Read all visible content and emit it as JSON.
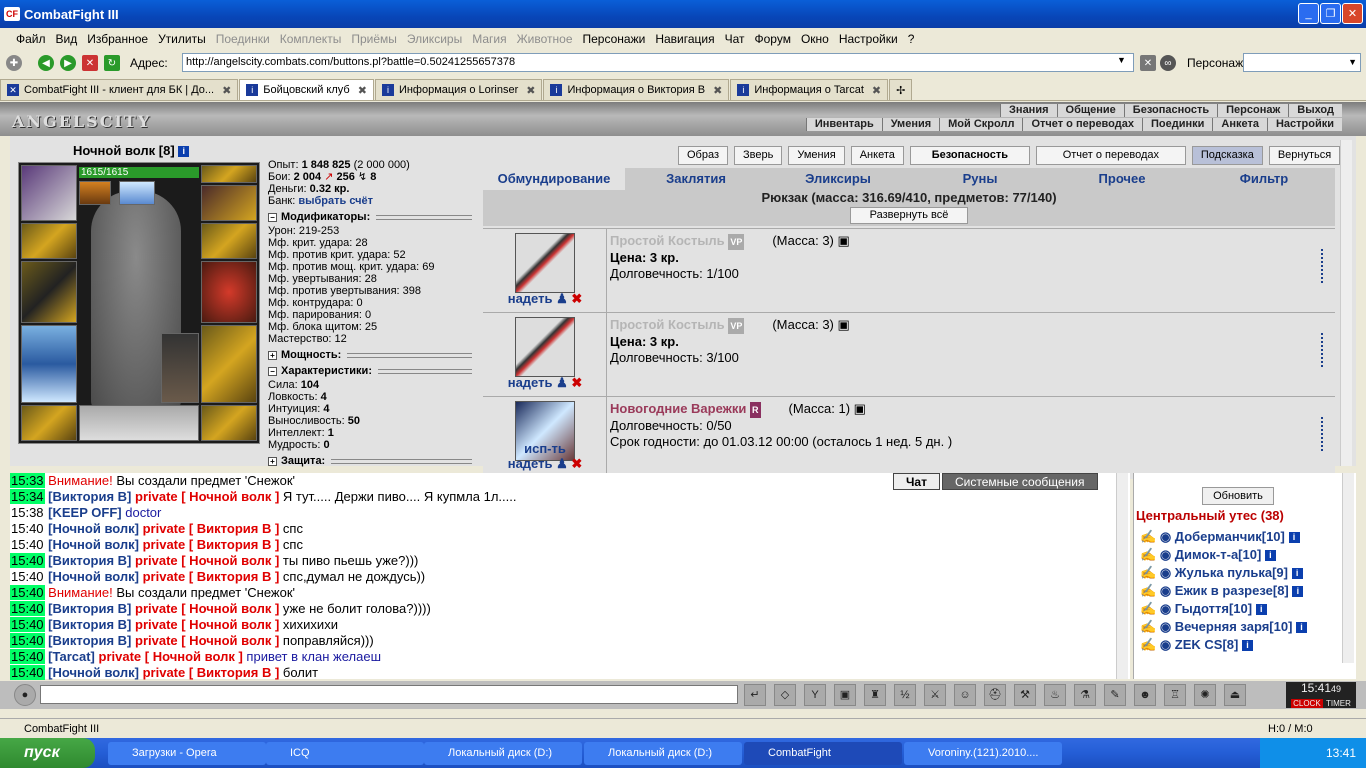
{
  "window": {
    "title": "CombatFight III"
  },
  "menu": {
    "items": [
      {
        "label": "Файл",
        "enabled": true
      },
      {
        "label": "Вид",
        "enabled": true
      },
      {
        "label": "Избранное",
        "enabled": true
      },
      {
        "label": "Утилиты",
        "enabled": true
      },
      {
        "label": "Поединки",
        "enabled": false
      },
      {
        "label": "Комплекты",
        "enabled": false
      },
      {
        "label": "Приёмы",
        "enabled": false
      },
      {
        "label": "Эликсиры",
        "enabled": false
      },
      {
        "label": "Магия",
        "enabled": false
      },
      {
        "label": "Животное",
        "enabled": false
      },
      {
        "label": "Персонажи",
        "enabled": true
      },
      {
        "label": "Навигация",
        "enabled": true
      },
      {
        "label": "Чат",
        "enabled": true
      },
      {
        "label": "Форум",
        "enabled": true
      },
      {
        "label": "Окно",
        "enabled": true
      },
      {
        "label": "Настройки",
        "enabled": true
      },
      {
        "label": "?",
        "enabled": true
      }
    ]
  },
  "address": {
    "label": "Адрес:",
    "url": "http://angelscity.combats.com/buttons.pl?battle=0.50241255657378",
    "persona_label": "Персонаж:"
  },
  "tabs": [
    {
      "label": "CombatFight III - клиент для БК | До..."
    },
    {
      "label": "Бойцовский клуб",
      "active": true
    },
    {
      "label": "Информация о Lorinser"
    },
    {
      "label": "Информация о Виктория В"
    },
    {
      "label": "Информация о Tarcat"
    }
  ],
  "header": {
    "logo": "ANGELSCITY",
    "links_row1": [
      "Знания",
      "Общение",
      "Безопасность",
      "Персонаж",
      "Выход"
    ],
    "links_row2": [
      "Инвентарь",
      "Умения",
      "Мой Скролл",
      "Отчет о переводах",
      "Поединки",
      "Анкета",
      "Настройки"
    ]
  },
  "character": {
    "name": "Ночной волк [8]",
    "hp": "1615/1615",
    "hp_fraction": 1.0,
    "stats": {
      "exp": "Опыт:",
      "exp_val": "1 848 825",
      "exp_next": "(2 000 000)",
      "fights": "Бои:",
      "fights_val": "2 004",
      "wins": "256",
      "losses": "8",
      "money": "Деньги:",
      "money_val": "0.32 кр.",
      "bank": "Банк:",
      "bank_link": "выбрать счёт"
    },
    "modifiers_title": "Модификаторы:",
    "modifiers": [
      "Урон: 219-253",
      "Мф. крит. удара: 28",
      "Мф. против крит. удара: 52",
      "Мф. против мощ. крит. удара: 69",
      "Мф. увертывания: 28",
      "Мф. против увертывания: 398",
      "Мф. контрудара: 0",
      "Мф. парирования: 0",
      "Мф. блока щитом: 25",
      "Мастерство: 12"
    ],
    "power_title": "Мощность:",
    "chars_title": "Характеристики:",
    "chars": [
      {
        "k": "Сила:",
        "v": "104"
      },
      {
        "k": "Ловкость:",
        "v": "4"
      },
      {
        "k": "Интуиция:",
        "v": "4"
      },
      {
        "k": "Выносливость:",
        "v": "50"
      },
      {
        "k": "Интеллект:",
        "v": "1"
      },
      {
        "k": "Мудрость:",
        "v": "0"
      }
    ],
    "defense_title": "Защита:"
  },
  "buttons": [
    "Образ",
    "Зверь",
    "Умения",
    "Анкета",
    "Безопасность",
    "Отчет о переводах",
    "Подсказка",
    "Вернуться"
  ],
  "inventory": {
    "tabs": [
      "Обмундирование",
      "Заклятия",
      "Эликсиры",
      "Руны",
      "Прочее",
      "Фильтр"
    ],
    "backpack": "Рюкзак (масса: 316.69/410, предметов: 77/140)",
    "expand": "Развернуть всё",
    "items": [
      {
        "name": "Простой Костыль",
        "tag": "VP",
        "mass": "(Масса: 3)",
        "price": "Цена: 3 кр.",
        "durability": "Долговечность: 1/100",
        "action": "надеть"
      },
      {
        "name": "Простой Костыль",
        "tag": "VP",
        "mass": "(Масса: 3)",
        "price": "Цена: 3 кр.",
        "durability": "Долговечность: 3/100",
        "action": "надеть"
      },
      {
        "name": "Новогодние Варежки",
        "tag": "R",
        "mass": "(Масса: 1)",
        "durability": "Долговечность: 0/50",
        "expiry": "Срок годности: до 01.03.12 00:00 (осталось 1 нед. 5 дн. )",
        "action": "исп-ть",
        "action2": "надеть"
      }
    ]
  },
  "chat": {
    "tabs": [
      "Чат",
      "Системные сообщения"
    ],
    "lines": [
      {
        "t": "15:33",
        "g": true,
        "warn": "Внимание!",
        "text": "Вы создали предмет 'Снежок'"
      },
      {
        "t": "15:34",
        "g": true,
        "nick": "[Виктория В]",
        "priv": "private [ Ночной волк ]",
        "text": "Я тут..... Держи пиво.... Я купмла 1л....."
      },
      {
        "t": "15:38",
        "g": false,
        "nick": "[KEEP OFF]",
        "blue": "doctor"
      },
      {
        "t": "15:40",
        "g": false,
        "nick": "[Ночной волк]",
        "priv": "private [ Виктория В ]",
        "text": "спс"
      },
      {
        "t": "15:40",
        "g": false,
        "nick": "[Ночной волк]",
        "priv": "private [ Виктория В ]",
        "text": "спс"
      },
      {
        "t": "15:40",
        "g": true,
        "nick": "[Виктория В]",
        "priv": "private [ Ночной волк ]",
        "text": "ты пиво пьешь уже?)))"
      },
      {
        "t": "15:40",
        "g": false,
        "nick": "[Ночной волк]",
        "priv": "private [ Виктория В ]",
        "text": "спс,думал не дождусь))"
      },
      {
        "t": "15:40",
        "g": true,
        "warn": "Внимание!",
        "text": "Вы создали предмет 'Снежок'"
      },
      {
        "t": "15:40",
        "g": true,
        "nick": "[Виктория В]",
        "priv": "private [ Ночной волк ]",
        "text": "уже не болит голова?))))"
      },
      {
        "t": "15:40",
        "g": true,
        "nick": "[Виктория В]",
        "priv": "private [ Ночной волк ]",
        "text": "хихихихи"
      },
      {
        "t": "15:40",
        "g": true,
        "nick": "[Виктория В]",
        "priv": "private [ Ночной волк ]",
        "text": "поправляйся)))"
      },
      {
        "t": "15:40",
        "g": true,
        "nick": "[Tarcat]",
        "priv": "private [ Ночной волк ]",
        "blue": "привет в клан желаеш"
      },
      {
        "t": "15:40",
        "g": true,
        "nick": "[Ночной волк]",
        "priv": "private [ Виктория В ]",
        "text": "болит"
      }
    ]
  },
  "room": {
    "refresh": "Обновить",
    "title": "Центральный утес (38)",
    "players": [
      "Доберманчик[10]",
      "Димок-т-а[10]",
      "Жулька пулька[9]",
      "Ежик в разрезе[8]",
      "Гыдоття[10]",
      "Вечерняя заря[10]",
      "ZEK CS[8]"
    ]
  },
  "clock": {
    "time": "15:41",
    "seconds": "49",
    "label1": "CLOCK",
    "label2": "TIMER"
  },
  "status": {
    "text": "CombatFight III",
    "hm": "H:0 / M:0"
  },
  "taskbar": {
    "start": "пуск",
    "items": [
      "Загрузки - Opera",
      "ICQ",
      "Локальный диск (D:)",
      "Локальный диск (D:)",
      "CombatFight",
      "Voroniny.(121).2010...."
    ],
    "time": "13:41"
  }
}
